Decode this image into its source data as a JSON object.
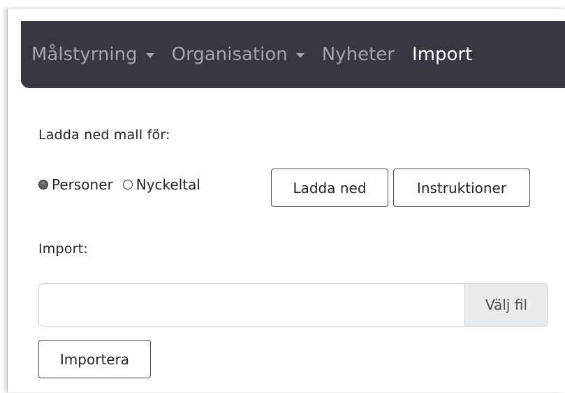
{
  "navbar": {
    "items": [
      {
        "label": "Målstyrning",
        "dropdown": true,
        "active": false
      },
      {
        "label": "Organisation",
        "dropdown": true,
        "active": false
      },
      {
        "label": "Nyheter",
        "dropdown": false,
        "active": false
      },
      {
        "label": "Import",
        "dropdown": false,
        "active": true
      }
    ],
    "background": "#343a40"
  },
  "template_section": {
    "label": "Ladda ned mall för:",
    "radios": [
      {
        "label": "Personer",
        "checked": true
      },
      {
        "label": "Nyckeltal",
        "checked": false
      }
    ],
    "download_button": "Ladda ned",
    "instructions_button": "Instruktioner"
  },
  "import_section": {
    "label": "Import:",
    "file_value": "",
    "browse_label": "Välj fil",
    "submit_button": "Importera"
  }
}
